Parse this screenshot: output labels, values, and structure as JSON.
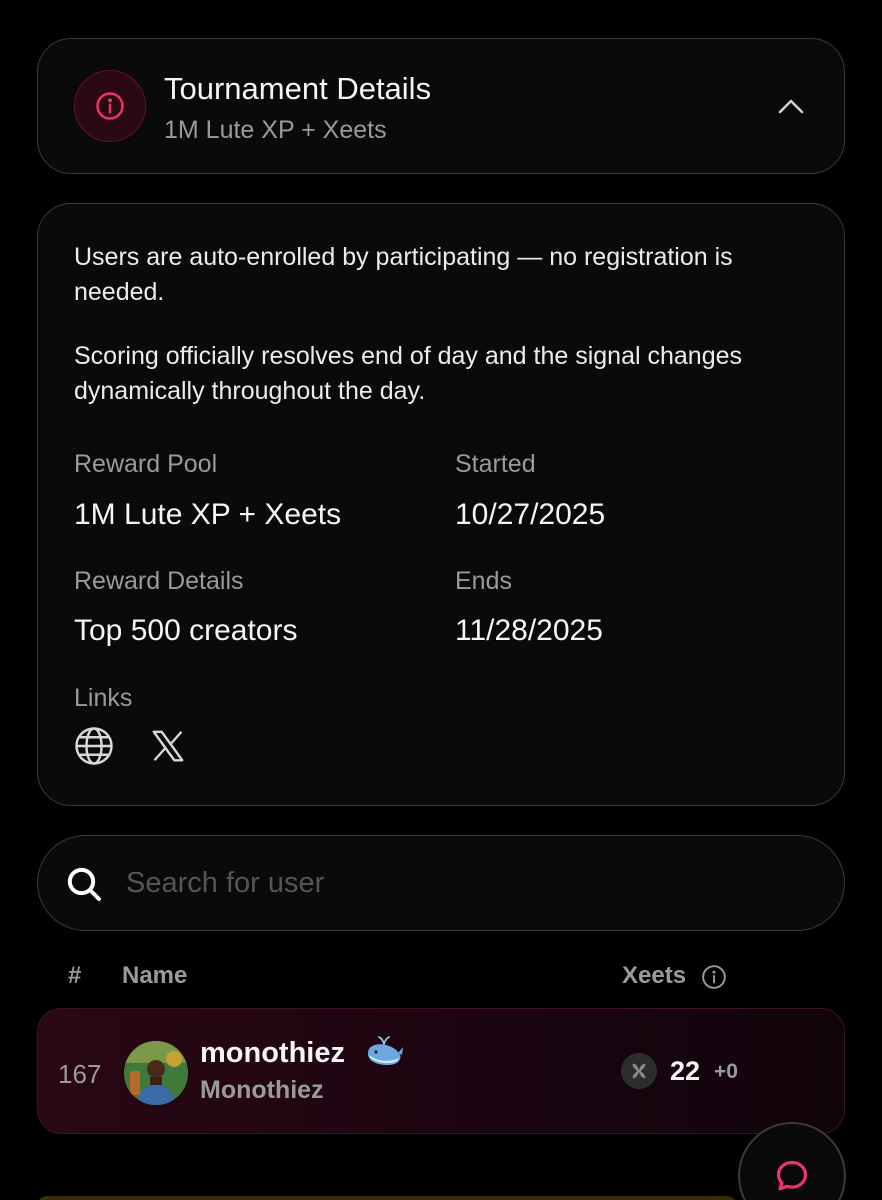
{
  "header": {
    "title": "Tournament Details",
    "subtitle": "1M Lute XP + Xeets",
    "icon": "info-icon",
    "toggle_icon": "chevron-up-icon"
  },
  "details": {
    "para1": "Users are auto-enrolled by participating — no registration is needed.",
    "para2": "Scoring officially resolves end of day and the signal changes dynamically throughout the day.",
    "reward_pool_label": "Reward Pool",
    "reward_pool_value": "1M Lute XP + Xeets",
    "started_label": "Started",
    "started_value": "10/27/2025",
    "reward_details_label": "Reward Details",
    "reward_details_value": "Top 500 creators",
    "ends_label": "Ends",
    "ends_value": "11/28/2025",
    "links_label": "Links",
    "links": [
      "globe-icon",
      "x-logo-icon"
    ]
  },
  "search": {
    "placeholder": "Search for user",
    "value": ""
  },
  "table": {
    "col_rank": "#",
    "col_name": "Name",
    "col_xeets": "Xeets",
    "rows": [
      {
        "rank": "167",
        "username": "monothiez",
        "badge": "whale-emoji",
        "handle": "Monothiez",
        "xeets": "22",
        "delta": "+0"
      }
    ]
  },
  "colors": {
    "accent": "#e8336b",
    "background": "#000000",
    "card_border": "#3a3a3a",
    "row_bg": "#2a0714"
  }
}
